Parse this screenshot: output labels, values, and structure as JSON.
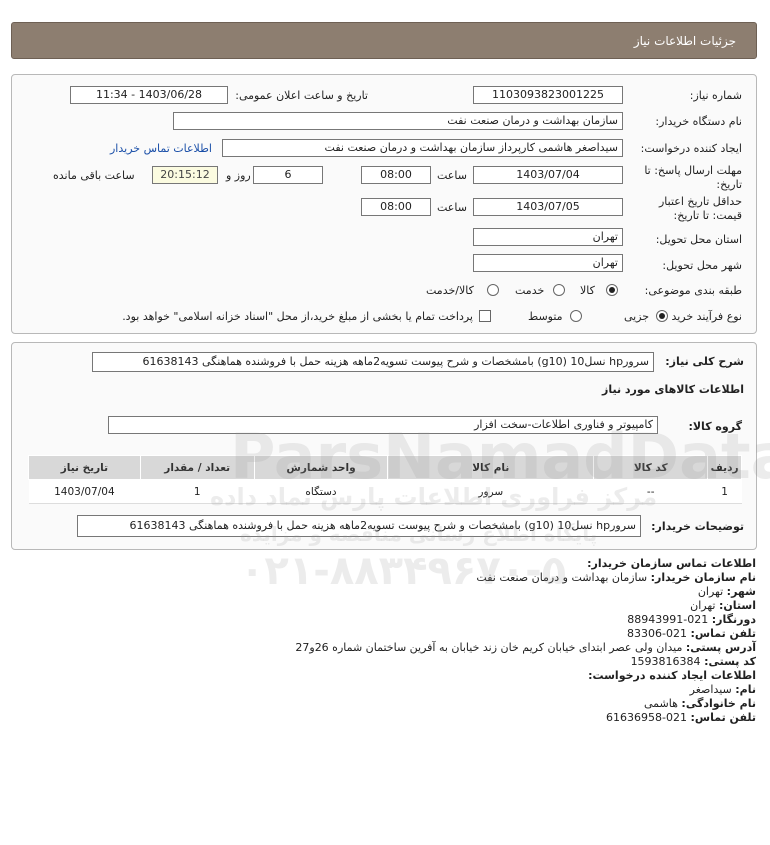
{
  "header": {
    "title": "جزئیات اطلاعات نیاز"
  },
  "form": {
    "need_number": {
      "label": "شماره نیاز:",
      "value": "1103093823001225"
    },
    "announce_datetime": {
      "label": "تاریخ و ساعت اعلان عمومی:",
      "value": "1403/06/28 - 11:34"
    },
    "buyer_org": {
      "label": "نام دستگاه خریدار:",
      "value": "سازمان بهداشت و درمان صنعت نفت"
    },
    "requester": {
      "label": "ایجاد کننده درخواست:",
      "value": "سیداصغر هاشمی کارپرداز سازمان بهداشت و درمان صنعت نفت"
    },
    "buyer_contact_link": "اطلاعات تماس خریدار",
    "deadline": {
      "label_line1": "مهلت ارسال پاسخ: تا",
      "label_line2": "تاریخ:",
      "date": "1403/07/04",
      "time_label": "ساعت",
      "time": "08:00",
      "days": "6",
      "days_label": "روز و",
      "remaining": "20:15:12",
      "remaining_label": "ساعت باقی مانده"
    },
    "price_validity": {
      "label_line1": "حداقل تاریخ اعتبار",
      "label_line2": "قیمت: تا تاریخ:",
      "date": "1403/07/05",
      "time_label": "ساعت",
      "time": "08:00"
    },
    "delivery_province": {
      "label": "استان محل تحویل:",
      "value": "تهران"
    },
    "delivery_city": {
      "label": "شهر محل تحویل:",
      "value": "تهران"
    },
    "category": {
      "label": "طبقه بندی موضوعی:",
      "options": [
        "کالا",
        "خدمت",
        "کالا/خدمت"
      ],
      "selected": "کالا"
    },
    "purchase_process": {
      "label": "نوع فرآیند خرید :",
      "options": [
        "جزیی",
        "متوسط"
      ],
      "selected": "جزیی",
      "checkbox_text": "پرداخت تمام یا بخشی از مبلغ خرید،از محل \"اسناد خزانه اسلامی\" خواهد بود."
    }
  },
  "description": {
    "label": "شرح کلی نیاز:",
    "value": "سرورhp نسل10 (g10) بامشخصات و شرح پیوست تسویه2ماهه هزینه حمل با فروشنده هماهنگی 61638143"
  },
  "goods_section_title": "اطلاعات کالاهای مورد نیاز",
  "goods_group": {
    "label": "گروه کالا:",
    "value": "کامپیوتر و فناوری اطلاعات-سخت افزار"
  },
  "table": {
    "headers": [
      "ردیف",
      "کد کالا",
      "نام کالا",
      "واحد شمارش",
      "تعداد / مقدار",
      "تاریخ نیاز"
    ],
    "rows": [
      [
        "1",
        "--",
        "سرور",
        "دستگاه",
        "1",
        "1403/07/04"
      ]
    ]
  },
  "buyer_notes": {
    "label": "توضیحات خریدار:",
    "value": "سرورhp نسل10 (g10) بامشخصات و شرح پیوست تسویه2ماهه هزینه حمل با فروشنده هماهنگی 61638143"
  },
  "contact": {
    "title": "اطلاعات تماس سازمان خریدار:",
    "org_name_label": "نام سازمان خریدار:",
    "org_name": "سازمان بهداشت و درمان صنعت نفت",
    "city_label": "شهر:",
    "city": "تهران",
    "province_label": "استان:",
    "province": "تهران",
    "fax_label": "دورنگار:",
    "fax": "021-88943991",
    "phone_label": "تلفن تماس:",
    "phone": "021-83306",
    "address_label": "آدرس پستی:",
    "address": "میدان ولی عصر ابتدای خیابان کریم خان زند خیابان به آفرین ساختمان شماره 26و27",
    "postal_label": "کد پستی:",
    "postal": "1593816384",
    "creator_title": "اطلاعات ایجاد کننده درخواست:",
    "first_name_label": "نام:",
    "first_name": "سیداصغر",
    "last_name_label": "نام خانوادگی:",
    "last_name": "هاشمی",
    "creator_phone_label": "تلفن تماس:",
    "creator_phone": "021-61636958"
  },
  "watermark": {
    "brand": "ParsNamadData",
    "tagline1": "مرکز فراوری اطلاعات پارس نماد داده",
    "tagline2": "پایگاه اطلاع رسانی مناقصه و مزایده",
    "phone": "۰۲۱-۸۸۳۴۹۶۷۰-۵"
  },
  "colors": {
    "header_bg": "#8d7e70",
    "link": "#1a4fa8",
    "table_header": "#d8d8d8"
  }
}
